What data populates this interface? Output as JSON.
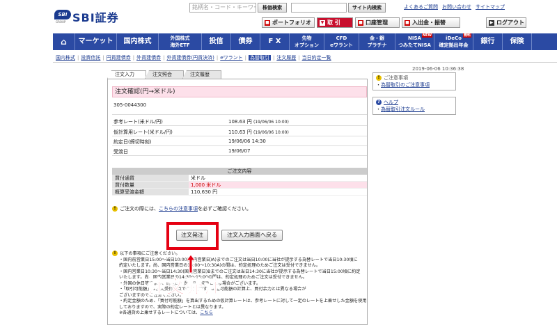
{
  "header": {
    "logo_mark": "SBI",
    "logo_group": "GROUP",
    "logo_text": "SBI証券",
    "search_placeholder": "銘柄名・コード・キーワード",
    "stock_search_label": "株価検索",
    "site_search_label": "サイト内検索",
    "links": [
      "よくあるご質問",
      "お問い合わせ",
      "サイトマップ"
    ],
    "toolbar": [
      {
        "label": "ポートフォリオ",
        "icon": "■"
      },
      {
        "label": "取 引",
        "icon": "▼"
      },
      {
        "label": "口座管理",
        "icon": "■"
      },
      {
        "label": "入出金・振替",
        "icon": "■"
      }
    ],
    "logout_label": "ログアウト"
  },
  "mainnav": [
    {
      "label": "⌂",
      "two": false
    },
    {
      "label": "マーケット",
      "two": false
    },
    {
      "label": "国内株式",
      "two": false
    },
    {
      "label": "外国株式\n海外ETF",
      "two": true
    },
    {
      "label": "投信",
      "two": false
    },
    {
      "label": "債券",
      "two": false
    },
    {
      "label": "F X",
      "two": false
    },
    {
      "label": "先物\nオプション",
      "two": true
    },
    {
      "label": "CFD\neワラント",
      "two": true
    },
    {
      "label": "金・銀\nプラチナ",
      "two": true
    },
    {
      "label": "NISA\nつみたてNISA",
      "two": true,
      "badge": "NEW"
    },
    {
      "label": "iDeCo\n確定拠出年金",
      "two": true,
      "badge": "無料"
    },
    {
      "label": "銀行",
      "two": false
    },
    {
      "label": "保険",
      "two": false
    }
  ],
  "subnav": [
    "国内株式",
    "投資信託",
    "円貨建債券",
    "外貨建債券",
    "外貨建債券(円貨決済)",
    "eワラント",
    "為替取引",
    "注文履歴",
    "当日約定一覧"
  ],
  "subnav_current": "為替取引",
  "tabs": [
    "注文入力",
    "注文照会",
    "注文履歴"
  ],
  "datetime": "2019-06-06 10:36:38",
  "order": {
    "title": "注文確認(円→米ドル)",
    "account": "305-0044300",
    "rows": [
      {
        "label": "参考レート(米ドル/円)",
        "value": "108.63 円",
        "note": "(19/06/06 10:00)"
      },
      {
        "label": "仮計算用レート(米ドル/円)",
        "value": "110.63 円",
        "note": "(19/06/06 10:00)"
      },
      {
        "label": "約定日(締切時刻)",
        "value": "19/06/06 14:30",
        "note": ""
      },
      {
        "label": "受渡日",
        "value": "19/06/07",
        "note": ""
      }
    ],
    "content_title": "ご注文内容",
    "content_rows": [
      {
        "label": "買付通貨",
        "value": "米ドル",
        "pink": false
      },
      {
        "label": "買付数量",
        "value": "1,000 米ドル",
        "pink": true
      },
      {
        "label": "概算受渡金額",
        "value": "110,630 円",
        "pink": false
      }
    ],
    "confirm_note_pre": "ご注文の際には、",
    "confirm_note_link": "こちらの注意事項",
    "confirm_note_post": "を必ずご確認ください。",
    "order_button": "注文発注",
    "back_button": "注文入力画面へ戻る"
  },
  "notes": {
    "heading": "以下の事項にご注意ください。",
    "lines": [
      "・国内前営業日15:00〜当日10:00(国内営業日)A)までのご注文は当日10:00に当社が提示する為替レートで当日10:30頃に",
      "約定いたします。尚、国内営業日の13:00〜10:30A)の間は、約定処理のためご注文は受付できません。",
      "・国内営業日10:30〜当日14:30(国内営業日)Bまでのご注文は当日14:30に当社が提示する為替レートで当日15:00頃に約定",
      "いたします。尚、国内営業日の14:30〜15:00の間は、約定処理のためご注文は受付できません。",
      "・外国の休日等により、約定日・受渡日は変更となる場合がございます。",
      "・「取引可能額」は注文受付時点での算出です。出金可能額の計算上、買付余力とは異なる場合が",
      "ございますのでご注意ください。",
      "・約定金額のため、「買付可能額」を算出するための仮計算レートは、参考レートに対して一定のレートを上乗せした金額を使用",
      "しておりますので、実際の約定レートとは異なります。",
      "※各通貨の上乗せするレートについては、"
    ],
    "last_link": "こちら"
  },
  "overlay_label": "注文発注",
  "side": {
    "notice_title": "ご注意事項",
    "notice_link": "為替取引のご注意事項",
    "help_title": "ヘルプ",
    "help_link": "為替取引注文ルール"
  },
  "colors": {
    "nav": "#2b4aa3",
    "accent_red": "#e50012",
    "pink": "#fde0ea"
  }
}
